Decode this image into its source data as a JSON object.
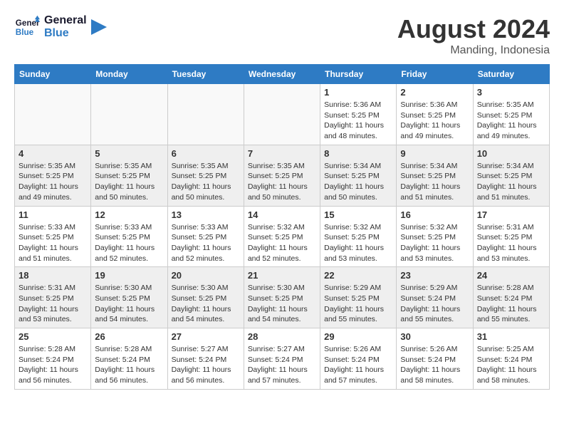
{
  "header": {
    "logo_line1": "General",
    "logo_line2": "Blue",
    "month_year": "August 2024",
    "location": "Manding, Indonesia"
  },
  "days_of_week": [
    "Sunday",
    "Monday",
    "Tuesday",
    "Wednesday",
    "Thursday",
    "Friday",
    "Saturday"
  ],
  "weeks": [
    [
      {
        "day": "",
        "info": ""
      },
      {
        "day": "",
        "info": ""
      },
      {
        "day": "",
        "info": ""
      },
      {
        "day": "",
        "info": ""
      },
      {
        "day": "1",
        "info": "Sunrise: 5:36 AM\nSunset: 5:25 PM\nDaylight: 11 hours\nand 48 minutes."
      },
      {
        "day": "2",
        "info": "Sunrise: 5:36 AM\nSunset: 5:25 PM\nDaylight: 11 hours\nand 49 minutes."
      },
      {
        "day": "3",
        "info": "Sunrise: 5:35 AM\nSunset: 5:25 PM\nDaylight: 11 hours\nand 49 minutes."
      }
    ],
    [
      {
        "day": "4",
        "info": "Sunrise: 5:35 AM\nSunset: 5:25 PM\nDaylight: 11 hours\nand 49 minutes."
      },
      {
        "day": "5",
        "info": "Sunrise: 5:35 AM\nSunset: 5:25 PM\nDaylight: 11 hours\nand 50 minutes."
      },
      {
        "day": "6",
        "info": "Sunrise: 5:35 AM\nSunset: 5:25 PM\nDaylight: 11 hours\nand 50 minutes."
      },
      {
        "day": "7",
        "info": "Sunrise: 5:35 AM\nSunset: 5:25 PM\nDaylight: 11 hours\nand 50 minutes."
      },
      {
        "day": "8",
        "info": "Sunrise: 5:34 AM\nSunset: 5:25 PM\nDaylight: 11 hours\nand 50 minutes."
      },
      {
        "day": "9",
        "info": "Sunrise: 5:34 AM\nSunset: 5:25 PM\nDaylight: 11 hours\nand 51 minutes."
      },
      {
        "day": "10",
        "info": "Sunrise: 5:34 AM\nSunset: 5:25 PM\nDaylight: 11 hours\nand 51 minutes."
      }
    ],
    [
      {
        "day": "11",
        "info": "Sunrise: 5:33 AM\nSunset: 5:25 PM\nDaylight: 11 hours\nand 51 minutes."
      },
      {
        "day": "12",
        "info": "Sunrise: 5:33 AM\nSunset: 5:25 PM\nDaylight: 11 hours\nand 52 minutes."
      },
      {
        "day": "13",
        "info": "Sunrise: 5:33 AM\nSunset: 5:25 PM\nDaylight: 11 hours\nand 52 minutes."
      },
      {
        "day": "14",
        "info": "Sunrise: 5:32 AM\nSunset: 5:25 PM\nDaylight: 11 hours\nand 52 minutes."
      },
      {
        "day": "15",
        "info": "Sunrise: 5:32 AM\nSunset: 5:25 PM\nDaylight: 11 hours\nand 53 minutes."
      },
      {
        "day": "16",
        "info": "Sunrise: 5:32 AM\nSunset: 5:25 PM\nDaylight: 11 hours\nand 53 minutes."
      },
      {
        "day": "17",
        "info": "Sunrise: 5:31 AM\nSunset: 5:25 PM\nDaylight: 11 hours\nand 53 minutes."
      }
    ],
    [
      {
        "day": "18",
        "info": "Sunrise: 5:31 AM\nSunset: 5:25 PM\nDaylight: 11 hours\nand 53 minutes."
      },
      {
        "day": "19",
        "info": "Sunrise: 5:30 AM\nSunset: 5:25 PM\nDaylight: 11 hours\nand 54 minutes."
      },
      {
        "day": "20",
        "info": "Sunrise: 5:30 AM\nSunset: 5:25 PM\nDaylight: 11 hours\nand 54 minutes."
      },
      {
        "day": "21",
        "info": "Sunrise: 5:30 AM\nSunset: 5:25 PM\nDaylight: 11 hours\nand 54 minutes."
      },
      {
        "day": "22",
        "info": "Sunrise: 5:29 AM\nSunset: 5:25 PM\nDaylight: 11 hours\nand 55 minutes."
      },
      {
        "day": "23",
        "info": "Sunrise: 5:29 AM\nSunset: 5:24 PM\nDaylight: 11 hours\nand 55 minutes."
      },
      {
        "day": "24",
        "info": "Sunrise: 5:28 AM\nSunset: 5:24 PM\nDaylight: 11 hours\nand 55 minutes."
      }
    ],
    [
      {
        "day": "25",
        "info": "Sunrise: 5:28 AM\nSunset: 5:24 PM\nDaylight: 11 hours\nand 56 minutes."
      },
      {
        "day": "26",
        "info": "Sunrise: 5:28 AM\nSunset: 5:24 PM\nDaylight: 11 hours\nand 56 minutes."
      },
      {
        "day": "27",
        "info": "Sunrise: 5:27 AM\nSunset: 5:24 PM\nDaylight: 11 hours\nand 56 minutes."
      },
      {
        "day": "28",
        "info": "Sunrise: 5:27 AM\nSunset: 5:24 PM\nDaylight: 11 hours\nand 57 minutes."
      },
      {
        "day": "29",
        "info": "Sunrise: 5:26 AM\nSunset: 5:24 PM\nDaylight: 11 hours\nand 57 minutes."
      },
      {
        "day": "30",
        "info": "Sunrise: 5:26 AM\nSunset: 5:24 PM\nDaylight: 11 hours\nand 58 minutes."
      },
      {
        "day": "31",
        "info": "Sunrise: 5:25 AM\nSunset: 5:24 PM\nDaylight: 11 hours\nand 58 minutes."
      }
    ]
  ]
}
